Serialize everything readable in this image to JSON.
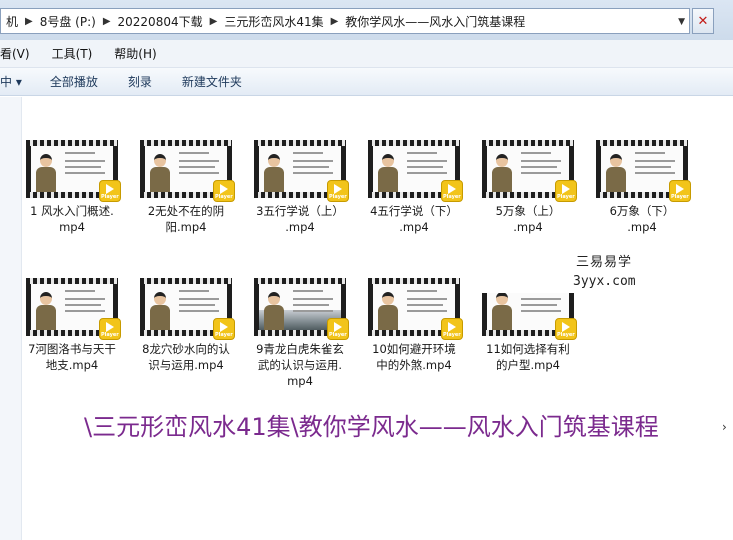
{
  "address_bar": {
    "crumbs": [
      "机",
      "8号盘 (P:)",
      "20220804下载",
      "三元形峦风水41集",
      "教你学风水——风水入门筑基课程"
    ],
    "close_glyph": "✕"
  },
  "menu": {
    "items": [
      "看(V)",
      "工具(T)",
      "帮助(H)"
    ]
  },
  "toolbar": {
    "organize_label": "中 ▾",
    "play_all_label": "全部播放",
    "burn_label": "刻录",
    "new_folder_label": "新建文件夹"
  },
  "files": [
    {
      "name": "1 风水入门概述.mp4"
    },
    {
      "name": "2无处不在的阴阳.mp4"
    },
    {
      "name": "3五行学说（上）.mp4"
    },
    {
      "name": "4五行学说（下）.mp4"
    },
    {
      "name": "5万象（上）.mp4"
    },
    {
      "name": "6万象（下）.mp4"
    },
    {
      "name": "7河图洛书与天干地支.mp4"
    },
    {
      "name": "8龙穴砂水向的认识与运用.mp4"
    },
    {
      "name": "9青龙白虎朱雀玄武的认识与运用.mp4"
    },
    {
      "name": "10如何避开环境中的外煞.mp4"
    },
    {
      "name": "11如何选择有利的户型.mp4"
    }
  ],
  "file_labels_display": [
    [
      "1 风水入门概述.",
      "mp4"
    ],
    [
      "2无处不在的阴",
      "阳.mp4"
    ],
    [
      "3五行学说（上）",
      ".mp4"
    ],
    [
      "4五行学说（下）",
      ".mp4"
    ],
    [
      "5万象（上）",
      ".mp4"
    ],
    [
      "6万象（下）",
      ".mp4"
    ],
    [
      "7河图洛书与天干",
      "地支.mp4"
    ],
    [
      "8龙穴砂水向的认",
      "识与运用.mp4"
    ],
    [
      "9青龙白虎朱雀玄",
      "武的认识与运用.",
      "mp4"
    ],
    [
      "10如何避开环境",
      "中的外煞.mp4"
    ],
    [
      "11如何选择有利",
      "的户型.mp4"
    ]
  ],
  "thumbnail_badge": "Player",
  "watermark": {
    "line1": "三易易学",
    "line2": "3yyx.com"
  },
  "caption": "\\三元形峦风水41集\\教你学风水——风水入门筑基课程",
  "colors": {
    "caption": "#7b2a8e",
    "player_badge": "#f2c41a"
  }
}
